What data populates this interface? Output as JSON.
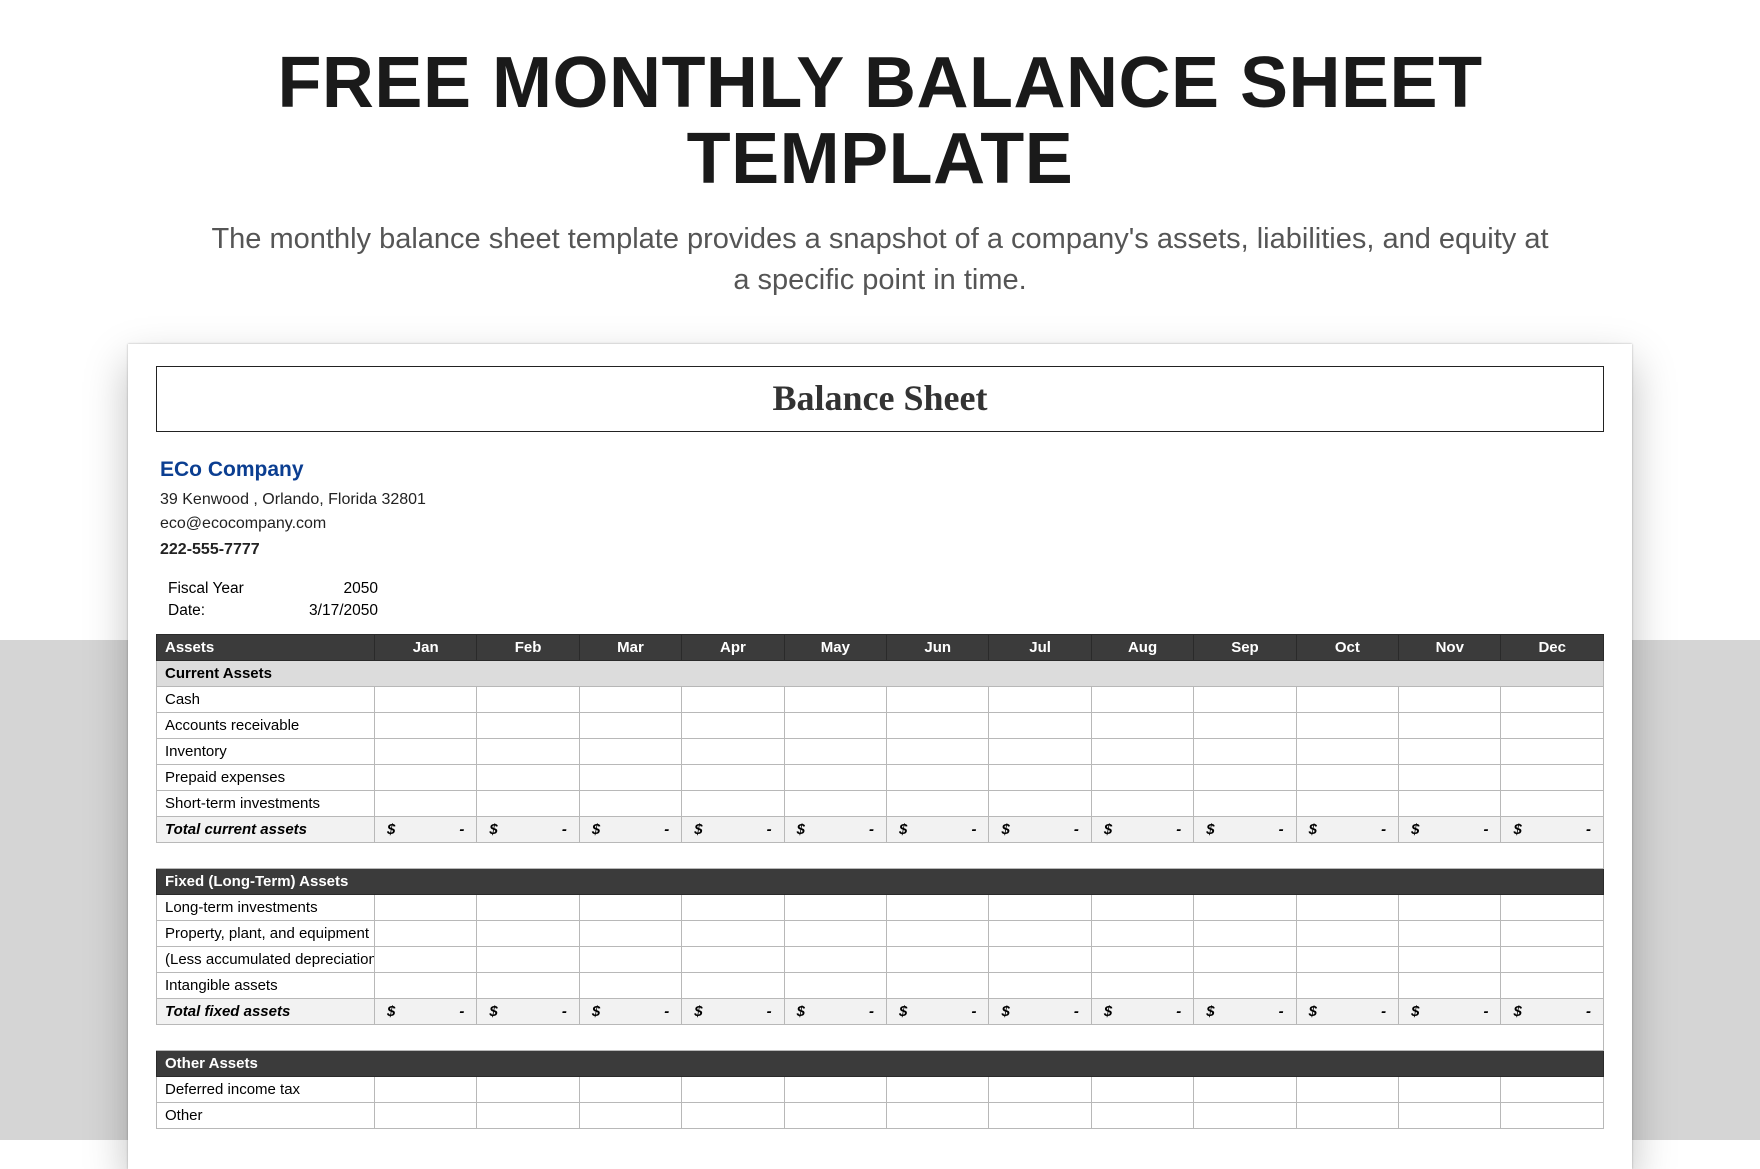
{
  "page": {
    "title": "FREE MONTHLY BALANCE SHEET TEMPLATE",
    "subtitle": "The monthly balance sheet template provides a snapshot of a company's assets, liabilities, and equity at a specific point in time."
  },
  "sheet": {
    "title": "Balance Sheet",
    "company": {
      "name": "ECo Company",
      "address": "39 Kenwood , Orlando, Florida 32801",
      "email": "eco@ecocompany.com",
      "phone": "222-555-7777"
    },
    "meta": {
      "fiscal_label": "Fiscal Year",
      "fiscal_value": "2050",
      "date_label": "Date:",
      "date_value": "3/17/2050"
    },
    "months": [
      "Jan",
      "Feb",
      "Mar",
      "Apr",
      "May",
      "Jun",
      "Jul",
      "Aug",
      "Sep",
      "Oct",
      "Nov",
      "Dec"
    ],
    "money_placeholder": {
      "currency": "$",
      "dash": "-"
    },
    "sections": [
      {
        "header_label": "Assets",
        "style": "dark_with_months",
        "subheader": "Current Assets",
        "rows": [
          "Cash",
          "Accounts receivable",
          "Inventory",
          "Prepaid expenses",
          "Short-term investments"
        ],
        "total_label": "Total current assets"
      },
      {
        "header_label": "Fixed (Long-Term) Assets",
        "style": "dark_span",
        "rows": [
          "Long-term investments",
          "Property, plant, and equipment",
          "(Less accumulated depreciation)",
          "Intangible assets"
        ],
        "total_label": "Total fixed assets"
      },
      {
        "header_label": "Other Assets",
        "style": "dark_span",
        "rows": [
          "Deferred income tax",
          "Other"
        ],
        "total_label": null
      }
    ]
  }
}
